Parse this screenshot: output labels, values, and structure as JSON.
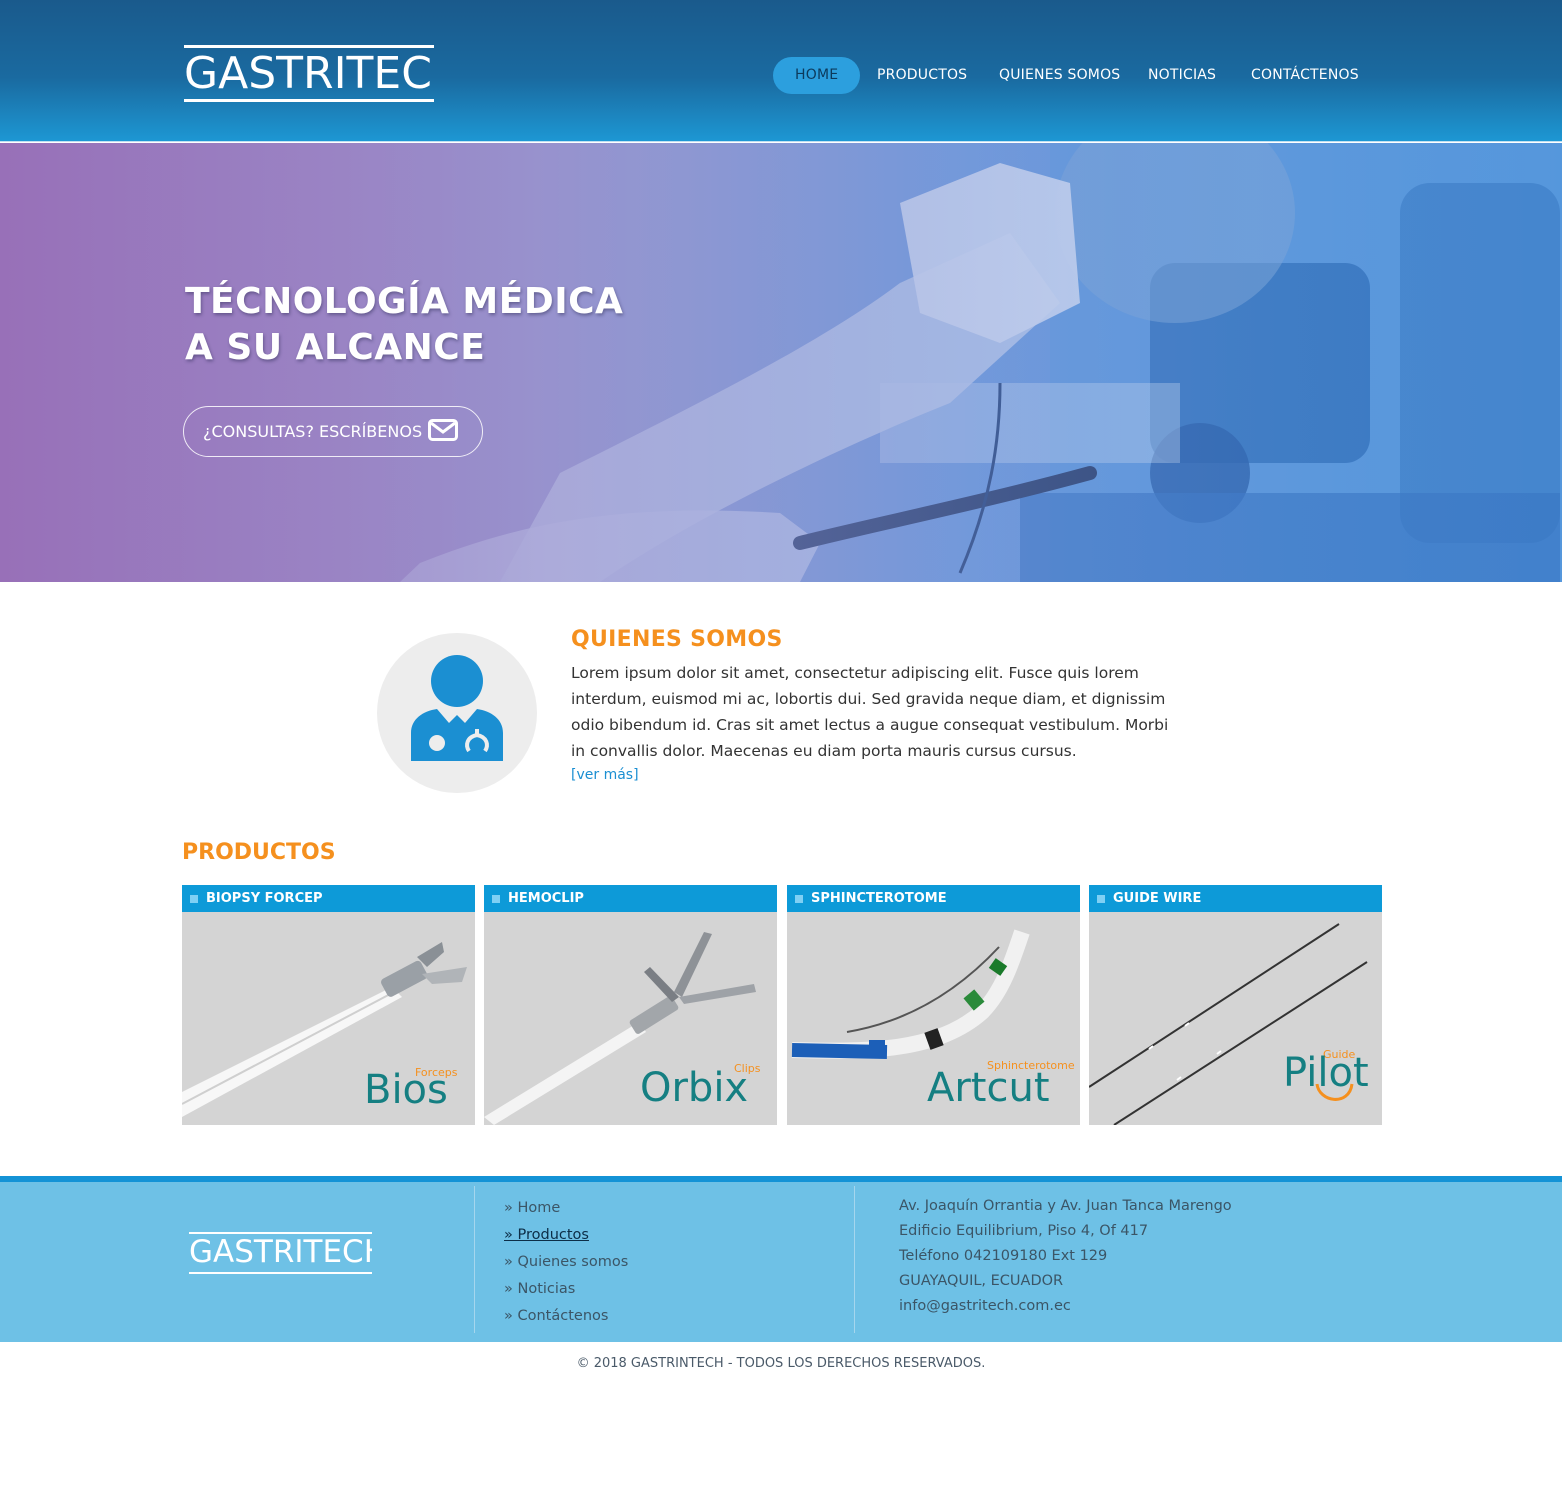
{
  "header": {
    "logo": "GASTRITECH",
    "nav": [
      {
        "label": "HOME",
        "active": true
      },
      {
        "label": "PRODUCTOS",
        "active": false
      },
      {
        "label": "QUIENES SOMOS",
        "active": false
      },
      {
        "label": "NOTICIAS",
        "active": false
      },
      {
        "label": "CONTÁCTENOS",
        "active": false
      }
    ]
  },
  "hero": {
    "title_line1": "TÉCNOLOGÍA MÉDICA",
    "title_line2": "A SU ALCANCE",
    "button_label": "¿CONSULTAS? ESCRÍBENOS",
    "button_icon": "envelope-icon"
  },
  "about": {
    "title": "QUIENES SOMOS",
    "text": "Lorem ipsum dolor sit amet, consectetur adipiscing elit. Fusce quis lorem interdum, euismod mi ac, lobortis dui. Sed gravida neque diam, et dignissim odio bibendum id. Cras sit amet lectus a augue consequat vestibulum. Morbi in convallis dolor. Maecenas eu diam porta mauris cursus cursus.",
    "more_link": "[ver más]",
    "avatar_icon": "doctor-icon"
  },
  "products": {
    "title": "PRODUCTOS",
    "items": [
      {
        "name": "BIOPSY FORCEP",
        "brand": "Bios",
        "brand_sub": "Forceps"
      },
      {
        "name": "HEMOCLIP",
        "brand": "Orbix",
        "brand_sub": "Clips"
      },
      {
        "name": "SPHINCTEROTOME",
        "brand": "Artcut",
        "brand_sub": "Sphincterotome"
      },
      {
        "name": "GUIDE WIRE",
        "brand": "Pilot",
        "brand_sub": "Guide"
      }
    ]
  },
  "footer": {
    "logo": "GASTRITECH",
    "links": [
      {
        "label": "» Home",
        "active": false
      },
      {
        "label": "» Productos",
        "active": true
      },
      {
        "label": "» Quienes somos",
        "active": false
      },
      {
        "label": "» Noticias",
        "active": false
      },
      {
        "label": "» Contáctenos",
        "active": false
      }
    ],
    "contact": [
      "Av. Joaquín Orrantia y Av. Juan Tanca Marengo",
      "Edificio Equilibrium, Piso 4, Of 417",
      "Teléfono 042109180 Ext 129",
      "GUAYAQUIL, ECUADOR",
      "info@gastritech.com.ec"
    ],
    "copyright": "© 2018 GASTRINTECH - TODOS LOS DERECHOS RESERVADOS."
  },
  "colors": {
    "accent_orange": "#f5901e",
    "brand_blue": "#0d9ad8",
    "footer_bg": "#6ec1e6",
    "teal": "#157f82"
  }
}
